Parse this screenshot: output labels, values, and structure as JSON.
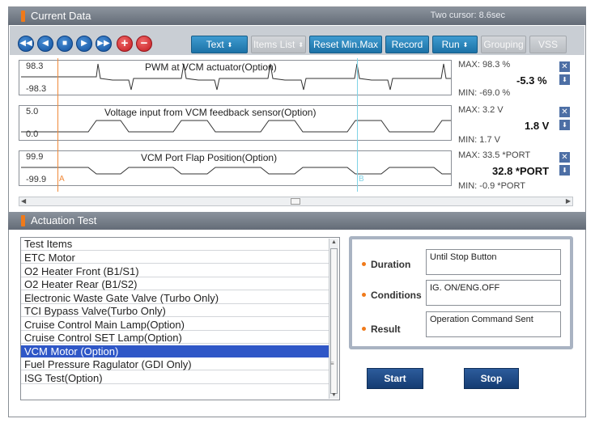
{
  "current_data": {
    "title": "Current Data",
    "cursor_info": "Two cursor: 8.6sec",
    "toolbar": {
      "nav_icons": [
        "rewind-icon",
        "step-back-icon",
        "stop-icon",
        "play-icon",
        "fast-forward-icon",
        "plus-icon",
        "minus-icon"
      ],
      "text_label": "Text",
      "items_list_label": "Items List",
      "reset_label": "Reset Min.Max",
      "record_label": "Record",
      "run_label": "Run",
      "grouping_label": "Grouping",
      "vss_label": "VSS",
      "spin_glyph": "⬍"
    },
    "graphs": [
      {
        "title": "PWM at VCM actuator(Option)",
        "max_axis": "98.3",
        "min_axis": "-98.3",
        "max_stat": "MAX:  98.3 %",
        "min_stat": "MIN:  -69.0 %",
        "current": "-5.3 %"
      },
      {
        "title": "Voltage input from VCM feedback sensor(Option)",
        "max_axis": "5.0",
        "min_axis": "0.0",
        "max_stat": "MAX:   3.2 V",
        "min_stat": "MIN:   1.7 V",
        "current": "1.8 V"
      },
      {
        "title": "VCM Port Flap Position(Option)",
        "max_axis": "99.9",
        "min_axis": "-99.9",
        "max_stat": "MAX:  33.5 *PORT",
        "min_stat": "MIN:  -0.9 *PORT",
        "current": "32.8 *PORT"
      }
    ],
    "cursor_a": "A",
    "cursor_b": "B",
    "close_glyph": "✕",
    "down_glyph": "⬇"
  },
  "actuation_test": {
    "title": "Actuation Test",
    "list_header": "Test Items",
    "items": [
      "ETC Motor",
      "O2 Heater Front (B1/S1)",
      "O2 Heater Rear (B1/S2)",
      "Electronic Waste Gate Valve (Turbo Only)",
      "TCI Bypass Valve(Turbo Only)",
      "Cruise Control Main Lamp(Option)",
      "Cruise Control SET Lamp(Option)",
      "VCM Motor (Option)",
      "Fuel Pressure Ragulator (GDI Only)",
      "ISG Test(Option)"
    ],
    "selected_index": 7,
    "labels": {
      "duration": "Duration",
      "conditions": "Conditions",
      "result": "Result"
    },
    "values": {
      "duration": "Until Stop Button",
      "conditions": "IG. ON/ENG.OFF",
      "result": "Operation Command Sent"
    },
    "start_label": "Start",
    "stop_label": "Stop"
  },
  "colors": {
    "header": "#6f7781",
    "accent": "#f07a1a",
    "selected": "#2f57c7",
    "cursor_a": "#f08a3a",
    "cursor_b": "#7fd3e6"
  }
}
